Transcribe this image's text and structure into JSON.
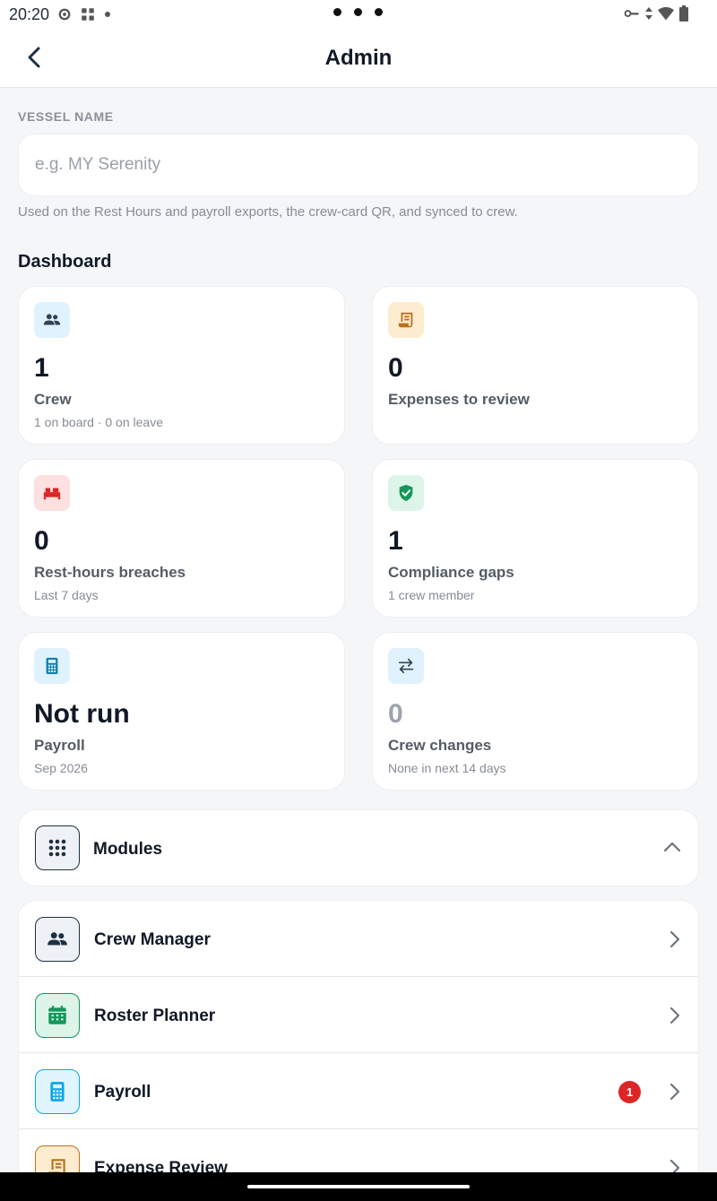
{
  "status_bar": {
    "time": "20:20"
  },
  "header": {
    "title": "Admin"
  },
  "vessel": {
    "section_label": "VESSEL NAME",
    "placeholder": "e.g. MY Serenity",
    "value": "",
    "hint": "Used on the Rest Hours and payroll exports, the crew-card QR, and synced to crew."
  },
  "dashboard": {
    "title": "Dashboard",
    "cards": [
      {
        "icon": "crew-icon",
        "value": "1",
        "label": "Crew",
        "sub": "1 on board · 0 on leave",
        "icon_bg": "#e0f2fe",
        "icon_color": "#334155"
      },
      {
        "icon": "receipt-icon",
        "value": "0",
        "label": "Expenses to review",
        "sub": "",
        "icon_bg": "#fdeccf",
        "icon_color": "#b9731b"
      },
      {
        "icon": "bed-icon",
        "value": "0",
        "label": "Rest-hours breaches",
        "sub": "Last 7 days",
        "icon_bg": "#fde0e0",
        "icon_color": "#dc2626"
      },
      {
        "icon": "shield-check-icon",
        "value": "1",
        "label": "Compliance gaps",
        "sub": "1 crew member",
        "icon_bg": "#dcf5e8",
        "icon_color": "#15965a"
      },
      {
        "icon": "calculator-icon",
        "value": "Not run",
        "label": "Payroll",
        "sub": "Sep 2026",
        "icon_bg": "#e0f2fe",
        "icon_color": "#0f7fb0"
      },
      {
        "icon": "swap-arrows-icon",
        "value": "0",
        "label": "Crew changes",
        "sub": "None in next 14 days",
        "icon_bg": "#e0f2fe",
        "icon_color": "#334155"
      }
    ]
  },
  "modules": {
    "label": "Modules",
    "items": [
      {
        "label": "Crew Manager",
        "icon": "crew-icon",
        "badge": ""
      },
      {
        "label": "Roster Planner",
        "icon": "calendar-icon",
        "badge": ""
      },
      {
        "label": "Payroll",
        "icon": "calculator-icon",
        "badge": "1"
      },
      {
        "label": "Expense Review",
        "icon": "receipt-icon",
        "badge": ""
      }
    ]
  },
  "colors": {
    "accent_dark": "#1f3044",
    "badge_red": "#dc2626",
    "green": "#15965a",
    "blue": "#0ea5e9",
    "amber": "#b9731b"
  }
}
